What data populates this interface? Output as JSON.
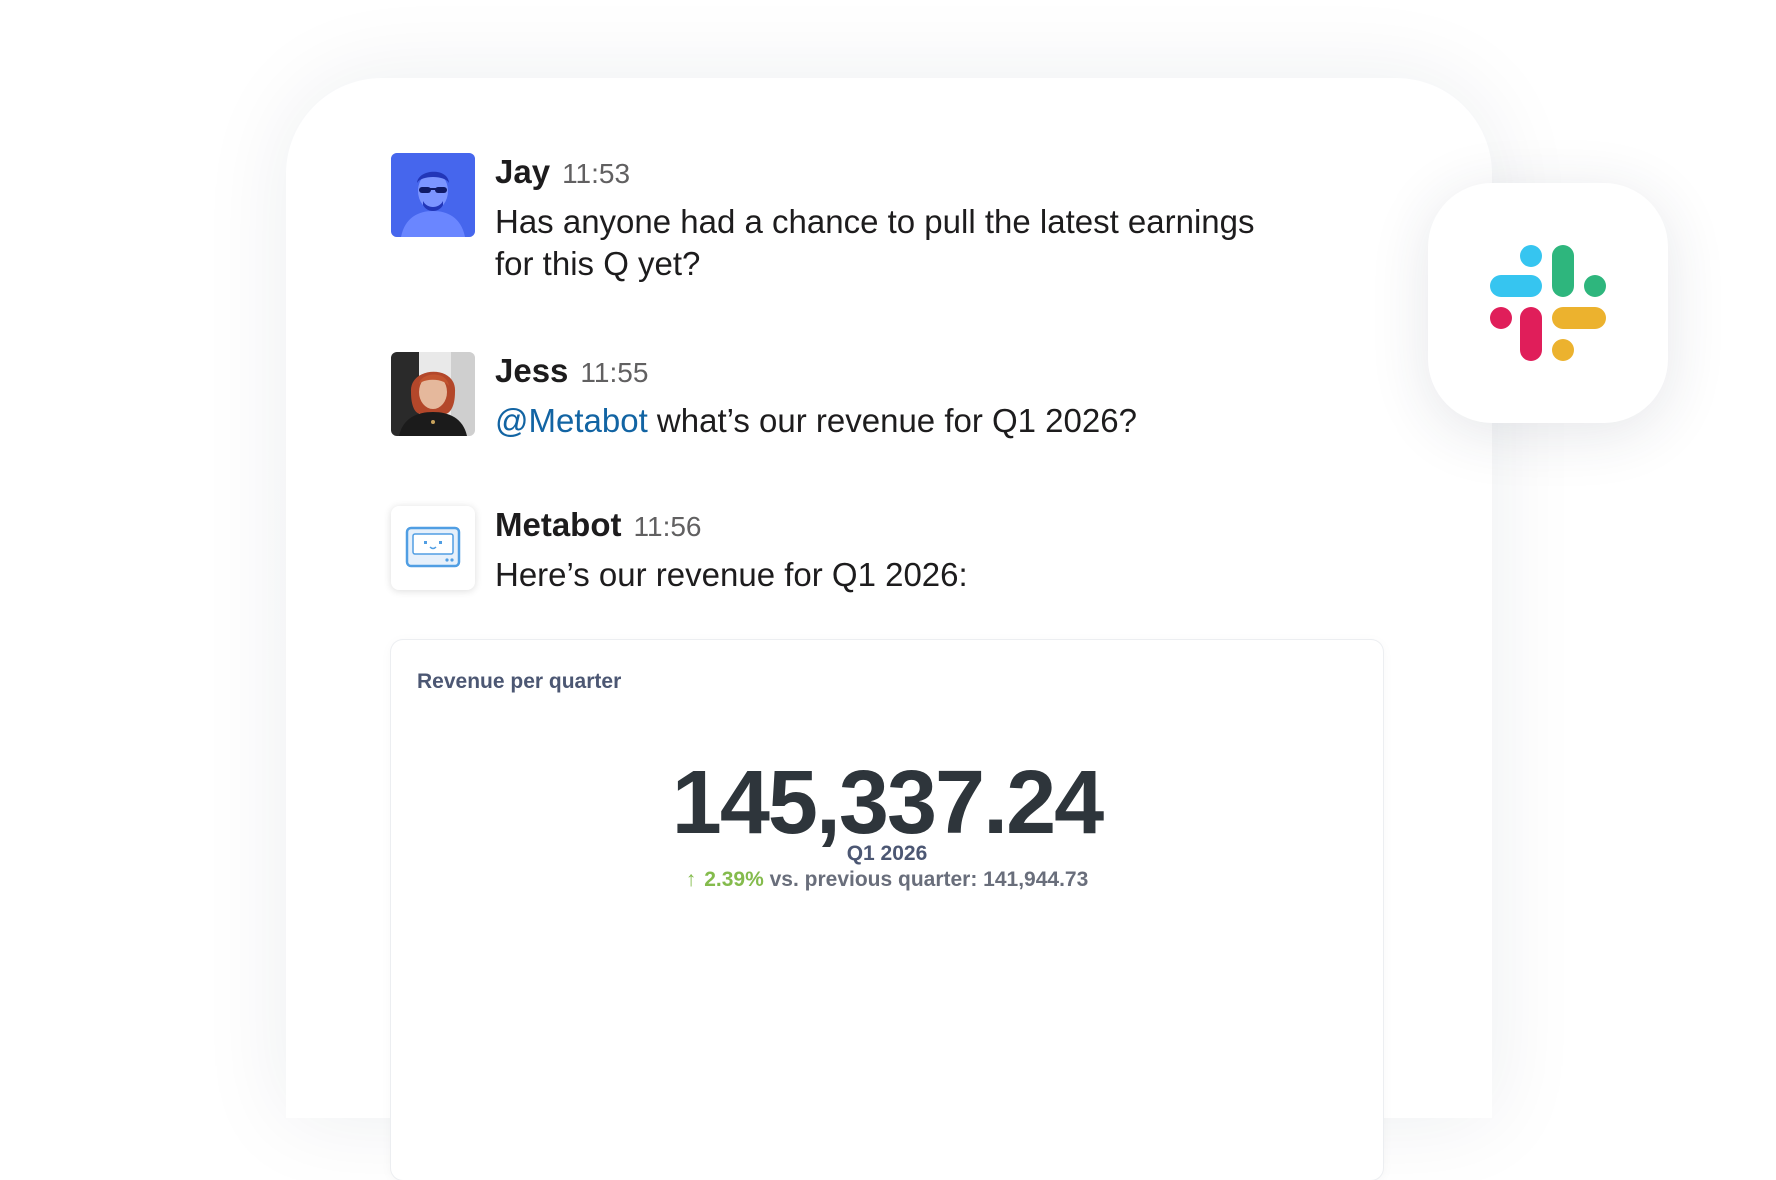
{
  "messages": [
    {
      "name": "Jay",
      "time": "11:53",
      "text": "Has anyone had a chance to pull the latest earnings for this Q yet?",
      "avatar": "jay-avatar"
    },
    {
      "name": "Jess",
      "time": "11:55",
      "mention": "@Metabot",
      "text": " what’s our revenue for Q1 2026?",
      "avatar": "jess-avatar"
    },
    {
      "name": "Metabot",
      "time": "11:56",
      "text": "Here’s our revenue for Q1 2026:",
      "avatar": "metabot-icon"
    }
  ],
  "card": {
    "title": "Revenue per quarter",
    "value": "145,337.24",
    "period": "Q1 2026",
    "change": "2.39%",
    "comparison": "vs. previous quarter: 141,944.73",
    "arrow": "↑"
  },
  "colors": {
    "mention": "#1264a3",
    "positive": "#84bb4c",
    "slack_blue": "#36c5f0",
    "slack_green": "#2eb67d",
    "slack_red": "#e01e5a",
    "slack_yellow": "#ecb22e"
  },
  "icons": [
    "slack-logo-icon",
    "metabot-icon"
  ]
}
